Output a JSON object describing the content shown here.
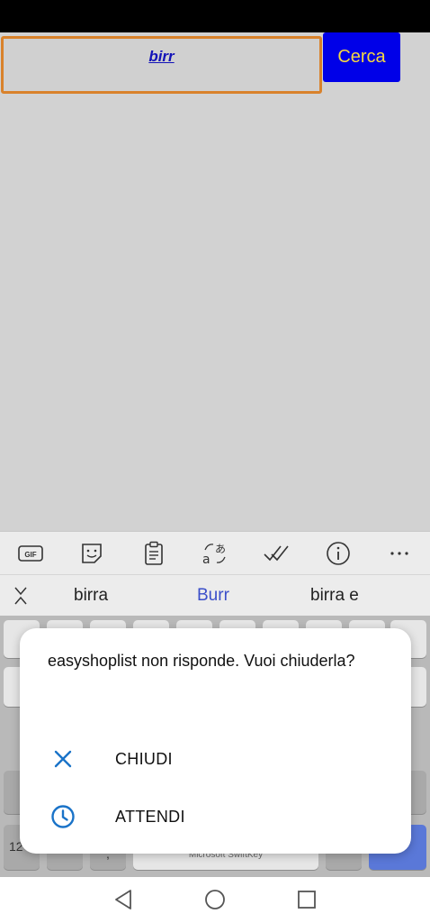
{
  "search": {
    "value": "birr",
    "button_label": "Cerca"
  },
  "keyboard": {
    "toolbar": [
      "gif-icon",
      "sticker-icon",
      "clipboard-icon",
      "translate-icon",
      "checkmark-icon",
      "info-icon",
      "more-icon"
    ],
    "suggestions": [
      "birra",
      "Burr",
      "birra e"
    ],
    "spacebar_label": "Microsoft SwiftKey",
    "visible_key_labels": {
      "numbers": "12",
      "comma": ","
    }
  },
  "dialog": {
    "message": "easyshoplist non risponde. Vuoi chiuderla?",
    "actions": [
      {
        "label": "CHIUDI",
        "icon": "close-icon"
      },
      {
        "label": "ATTENDI",
        "icon": "clock-icon"
      }
    ],
    "accent_color": "#1a73c8"
  },
  "navigation": {
    "buttons": [
      "back-icon",
      "home-icon",
      "recents-icon"
    ]
  }
}
